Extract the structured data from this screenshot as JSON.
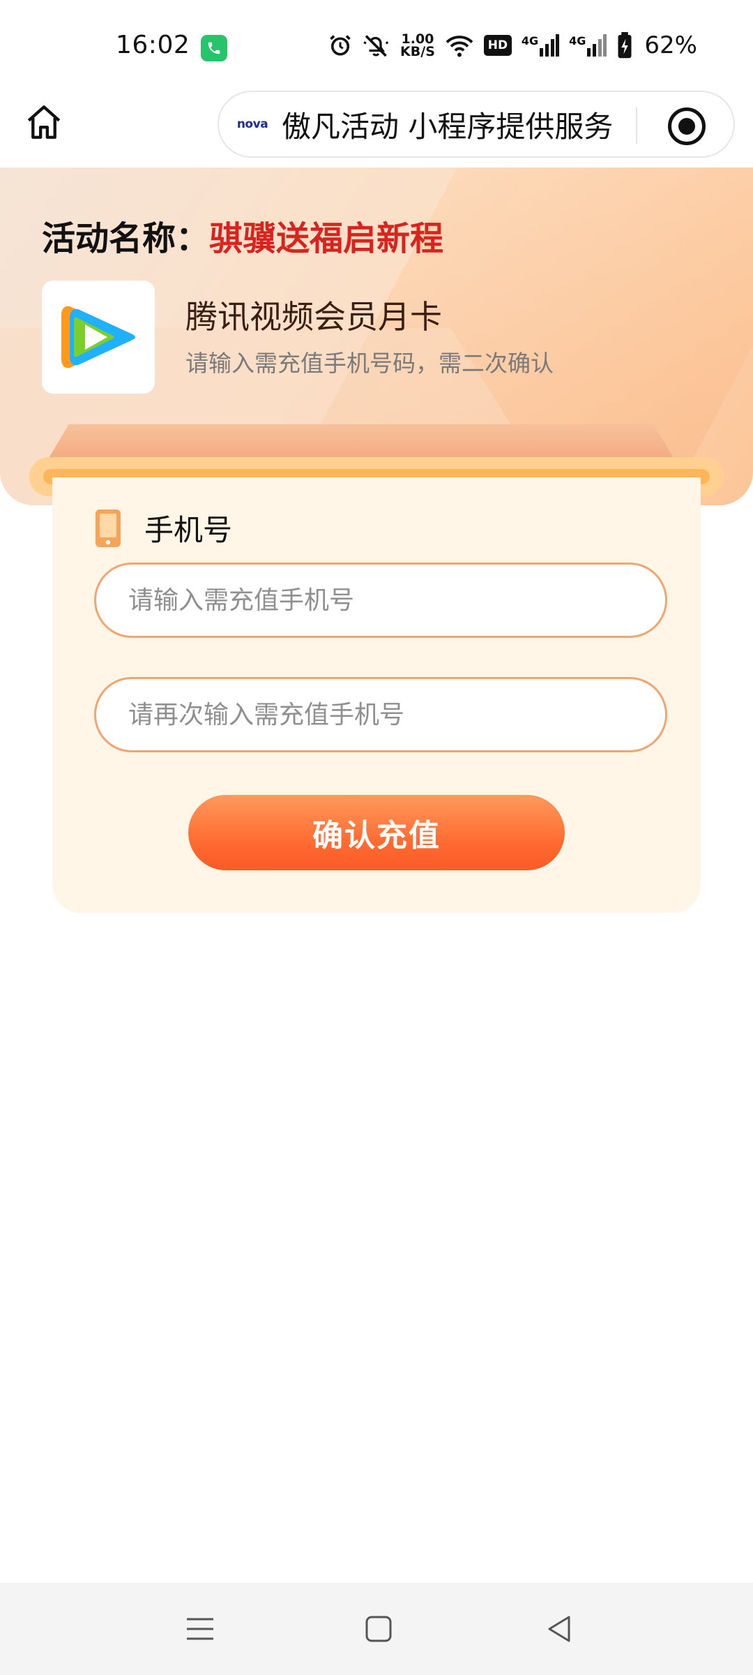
{
  "status_bar": {
    "time": "16:02",
    "net_speed_value": "1.00",
    "net_speed_unit": "KB/S",
    "hd_label": "HD",
    "signal1_label": "4G",
    "signal2_label": "4G",
    "battery_percent": "62%"
  },
  "nav": {
    "capsule_logo": "nova",
    "capsule_title": "傲凡活动 小程序提供服务"
  },
  "banner": {
    "activity_label": "活动名称：",
    "activity_name": "骐骥送福启新程",
    "product_title": "腾讯视频会员月卡",
    "product_subtitle": "请输入需充值手机号码，需二次确认"
  },
  "form": {
    "phone_label": "手机号",
    "phone_placeholder": "请输入需充值手机号",
    "phone_confirm_placeholder": "请再次输入需充值手机号",
    "submit_label": "确认充值"
  },
  "colors": {
    "accent": "#ff6d33",
    "activity_name": "#d8231e",
    "input_border": "#f1a571",
    "card_bg": "#fff6e7"
  }
}
